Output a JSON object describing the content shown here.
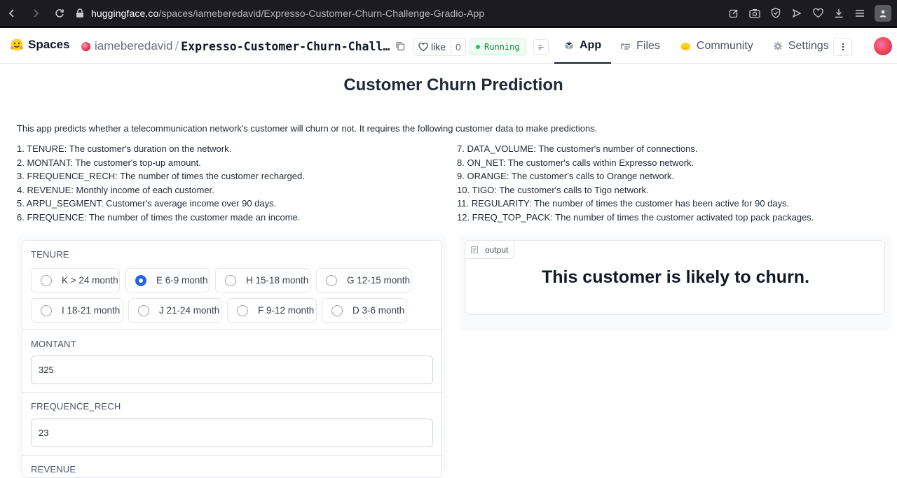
{
  "browser": {
    "url_host": "huggingface.co",
    "url_path": "/spaces/iameberedavid/Expresso-Customer-Churn-Challenge-Gradio-App"
  },
  "header": {
    "spaces_label": "Spaces",
    "owner": "iameberedavid",
    "separator": "/",
    "repo_name": "Expresso-Customer-Churn-Challenge-Gradio-App",
    "like_label": "like",
    "like_count": "0",
    "status": "Running",
    "tabs": [
      {
        "label": "App",
        "icon": "app-cube-icon"
      },
      {
        "label": "Files",
        "icon": "files-icon"
      },
      {
        "label": "Community",
        "icon": "community-hand-icon"
      },
      {
        "label": "Settings",
        "icon": "gear-icon"
      }
    ]
  },
  "page": {
    "title": "Customer Churn Prediction",
    "description": "This app predicts whether a telecommunication network's customer will churn or not. It requires the following customer data to make predictions.",
    "features_left": [
      "1. TENURE: The customer's duration on the network.",
      "2. MONTANT: The customer's top-up amount.",
      "3. FREQUENCE_RECH: The number of times the customer recharged.",
      "4. REVENUE: Monthly income of each customer.",
      "5. ARPU_SEGMENT: Customer's average income over 90 days.",
      "6. FREQUENCE: The number of times the customer made an income."
    ],
    "features_right": [
      "7. DATA_VOLUME: The customer's number of connections.",
      "8. ON_NET: The customer's calls within Expresso network.",
      "9. ORANGE: The customer's calls to Orange network.",
      "10. TIGO: The customer's calls to Tigo network.",
      "11. REGULARITY: The number of times the customer has been active for 90 days.",
      "12. FREQ_TOP_PACK: The number of times the customer activated top pack packages."
    ]
  },
  "form": {
    "tenure_label": "TENURE",
    "tenure_options": [
      "K > 24 month",
      "E 6-9 month",
      "H 15-18 month",
      "G 12-15 month",
      "I 18-21 month",
      "J 21-24 month",
      "F 9-12 month",
      "D 3-6 month"
    ],
    "tenure_selected": "E 6-9 month",
    "montant_label": "MONTANT",
    "montant_value": "325",
    "frequence_rech_label": "FREQUENCE_RECH",
    "frequence_rech_value": "23",
    "revenue_label": "REVENUE"
  },
  "output": {
    "label": "output",
    "text": "This customer is likely to churn."
  },
  "colors": {
    "accent": "#2563eb",
    "running_green": "#22c55e",
    "browser_bar": "#1c1b22"
  }
}
